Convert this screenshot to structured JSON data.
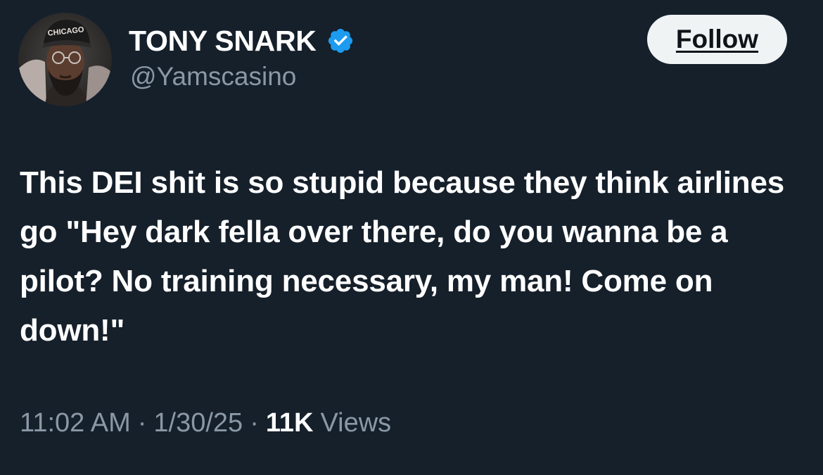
{
  "author": {
    "display_name": "TONY SNARK",
    "handle": "@Yamscasino",
    "verified": true,
    "avatar_hat_text": "CHICAGO"
  },
  "follow_button": {
    "label": "Follow"
  },
  "tweet": {
    "text": "This DEI shit is so stupid because they think airlines go \"Hey dark fella over there, do you wanna be a pilot? No training necessary, my man! Come on down!\""
  },
  "meta": {
    "time": "11:02 AM",
    "separator": "·",
    "date": "1/30/25",
    "views_count": "11K",
    "views_label": "Views"
  },
  "colors": {
    "background": "#15202b",
    "verified_badge": "#1d9bf0",
    "secondary_text": "#8b98a5",
    "follow_button_bg": "#eff3f4"
  },
  "icons": {
    "verified": "verified-badge-icon"
  }
}
